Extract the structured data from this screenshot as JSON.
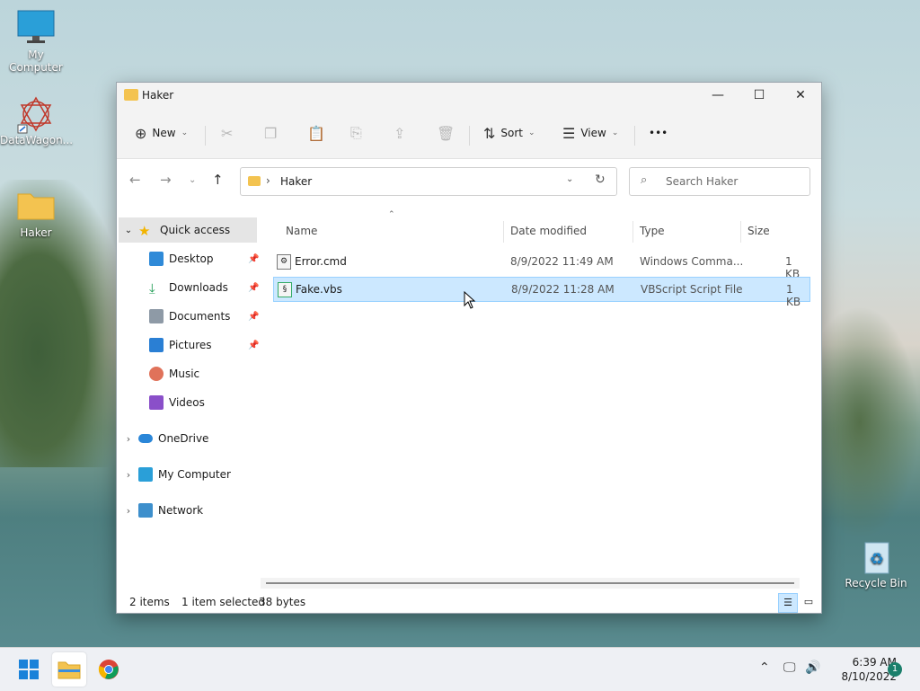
{
  "desktop": {
    "icons": [
      {
        "label": "My Computer"
      },
      {
        "label": "DataWagon..."
      },
      {
        "label": "Haker"
      },
      {
        "label": "Recycle Bin"
      }
    ]
  },
  "window": {
    "title": "Haker",
    "controls": {
      "minimize": "—",
      "maximize": "☐",
      "close": "✕"
    }
  },
  "toolbar": {
    "new_label": "New",
    "sort_label": "Sort",
    "view_label": "View",
    "more_label": "•••"
  },
  "address": {
    "path": "Haker",
    "search_placeholder": "Search Haker"
  },
  "navpane": {
    "quick_access": "Quick access",
    "items": [
      {
        "label": "Desktop",
        "pinned": true
      },
      {
        "label": "Downloads",
        "pinned": true
      },
      {
        "label": "Documents",
        "pinned": true
      },
      {
        "label": "Pictures",
        "pinned": true
      },
      {
        "label": "Music",
        "pinned": false
      },
      {
        "label": "Videos",
        "pinned": false
      }
    ],
    "onedrive": "OneDrive",
    "my_computer": "My Computer",
    "network": "Network"
  },
  "files": {
    "columns": {
      "name": "Name",
      "date": "Date modified",
      "type": "Type",
      "size": "Size"
    },
    "rows": [
      {
        "name": "Error.cmd",
        "date": "8/9/2022 11:49 AM",
        "type": "Windows Comma...",
        "size": "1 KB",
        "selected": false
      },
      {
        "name": "Fake.vbs",
        "date": "8/9/2022 11:28 AM",
        "type": "VBScript Script File",
        "size": "1 KB",
        "selected": true
      }
    ]
  },
  "status": {
    "items": "2 items",
    "selected": "1 item selected",
    "bytes": "38 bytes"
  },
  "taskbar": {
    "time": "6:39 AM",
    "date": "8/10/2022",
    "notifications": "1"
  },
  "colors": {
    "accent": "#0067c0",
    "selection": "#cce8ff",
    "folder": "#f3c350"
  }
}
